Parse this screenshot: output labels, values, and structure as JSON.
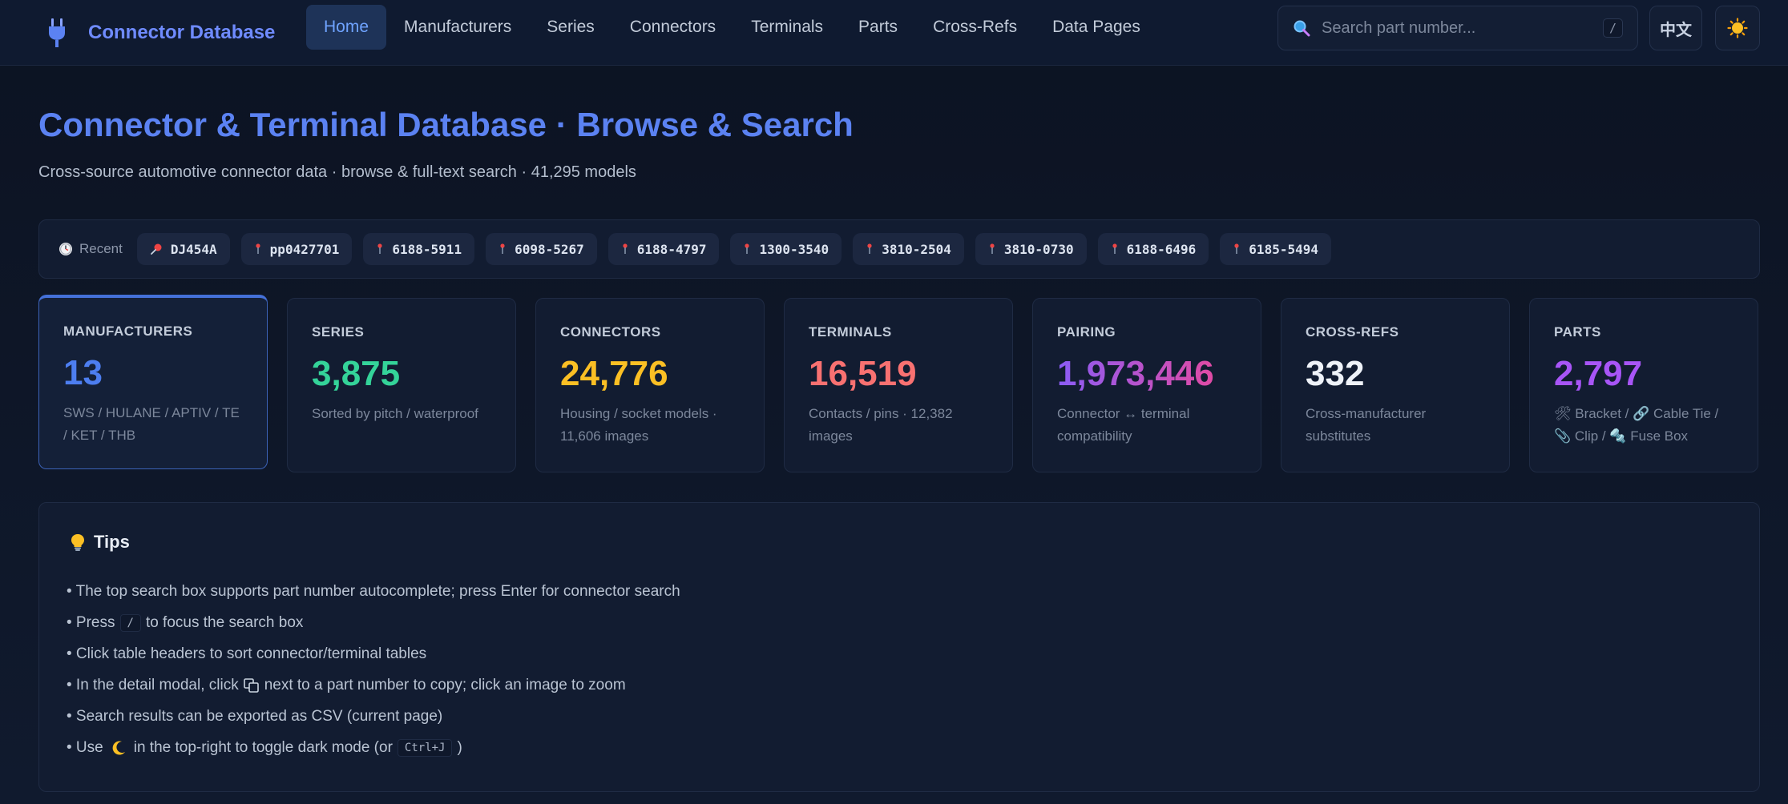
{
  "app": {
    "title": "Connector Database"
  },
  "nav": {
    "items": [
      {
        "label": "Home",
        "active": true
      },
      {
        "label": "Manufacturers"
      },
      {
        "label": "Series"
      },
      {
        "label": "Connectors"
      },
      {
        "label": "Terminals"
      },
      {
        "label": "Parts"
      },
      {
        "label": "Cross-Refs"
      },
      {
        "label": "Data Pages"
      }
    ]
  },
  "search": {
    "placeholder": "Search part number...",
    "shortcut": "/"
  },
  "lang_button": {
    "label": "中文"
  },
  "theme_button": {
    "icon": "sun-icon"
  },
  "header": {
    "title": "Connector & Terminal Database · Browse & Search",
    "subtitle": "Cross-source automotive connector data · browse & full-text search · 41,295 models"
  },
  "recent": {
    "label": "Recent",
    "items": [
      "DJ454A",
      "pp0427701",
      "6188-5911",
      "6098-5267",
      "6188-4797",
      "1300-3540",
      "3810-2504",
      "3810-0730",
      "6188-6496",
      "6185-5494"
    ]
  },
  "stats": [
    {
      "label": "MANUFACTURERS",
      "value": "13",
      "desc": "SWS / HULANE / APTIV / TE / KET / THB",
      "color": "#4d7ef0"
    },
    {
      "label": "SERIES",
      "value": "3,875",
      "desc": "Sorted by pitch / waterproof",
      "color": "#34d399"
    },
    {
      "label": "CONNECTORS",
      "value": "24,776",
      "desc": "Housing / socket models · 11,606 images",
      "color": "#fbbf24"
    },
    {
      "label": "TERMINALS",
      "value": "16,519",
      "desc": "Contacts / pins · 12,382 images",
      "color": "#f87171"
    },
    {
      "label": "PAIRING",
      "value": "1,973,446",
      "desc": "Connector ↔ terminal compatibility",
      "color": "#a855f7"
    },
    {
      "label": "CROSS-REFS",
      "value": "332",
      "desc": "Cross-manufacturer substitutes",
      "color": "#eef2f8"
    },
    {
      "label": "PARTS",
      "value": "2,797",
      "desc": "🛠 Bracket / 🔗 Cable Tie / 📎 Clip / 🔩 Fuse Box",
      "color": "#a855f7"
    }
  ],
  "tips": {
    "title": "Tips",
    "items": {
      "t1": "• The top search box supports part number autocomplete; press Enter for connector search",
      "t2a": "• Press",
      "t2k": "/",
      "t2b": "to focus the search box",
      "t3": "• Click table headers to sort connector/terminal tables",
      "t4a": "• In the detail modal, click",
      "t4b": "next to a part number to copy; click an image to zoom",
      "t5": "• Search results can be exported as CSV (current page)",
      "t6a": "• Use",
      "t6b": "in the top-right to toggle dark mode (or",
      "t6k": "Ctrl+J",
      "t6c": ")"
    }
  }
}
